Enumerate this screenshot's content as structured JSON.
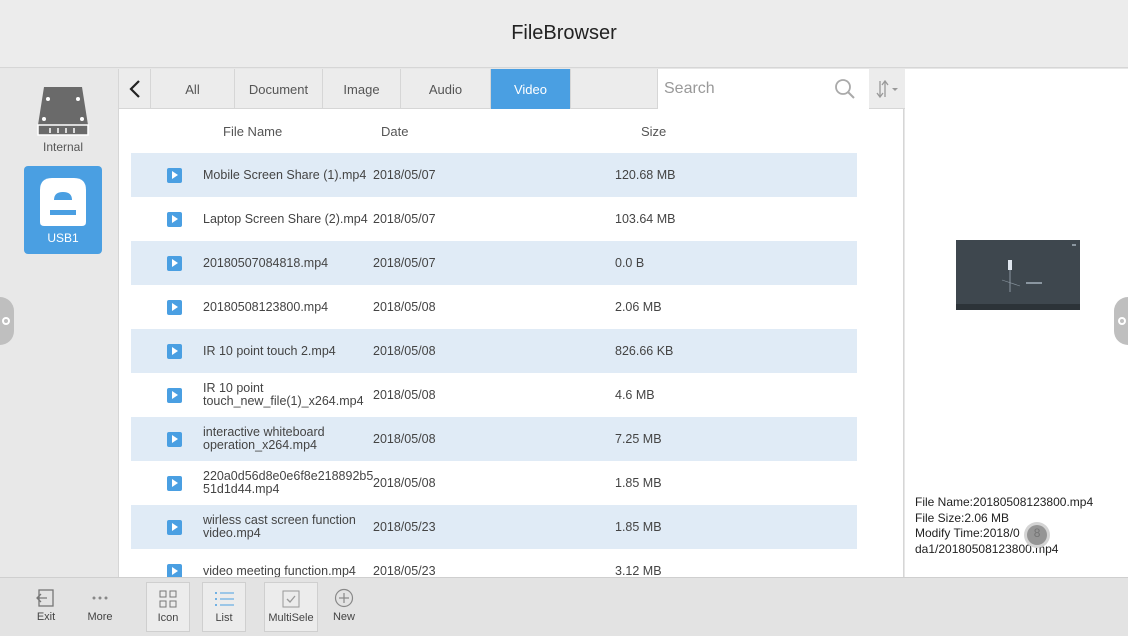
{
  "app": {
    "title": "FileBrowser"
  },
  "devices": [
    {
      "label": "Internal",
      "icon": "hard-drive-icon"
    },
    {
      "label": "USB1",
      "icon": "usb-drive-icon",
      "selected": true
    }
  ],
  "toolbar": {
    "back_icon": "chevron-left-icon",
    "tabs": [
      {
        "label": "All"
      },
      {
        "label": "Document"
      },
      {
        "label": "Image"
      },
      {
        "label": "Audio"
      },
      {
        "label": "Video",
        "active": true
      }
    ],
    "search": {
      "placeholder": "Search",
      "icon": "search-icon"
    },
    "sort_icon": "sort-icon"
  },
  "columns": {
    "name": "File Name",
    "date": "Date",
    "size": "Size"
  },
  "files": [
    {
      "name": "Mobile Screen Share (1).mp4",
      "date": "2018/05/07",
      "size": "120.68 MB"
    },
    {
      "name": "Laptop Screen Share (2).mp4",
      "date": "2018/05/07",
      "size": "103.64 MB"
    },
    {
      "name": "20180507084818.mp4",
      "date": "2018/05/07",
      "size": "0.0 B"
    },
    {
      "name": "20180508123800.mp4",
      "date": "2018/05/08",
      "size": "2.06 MB"
    },
    {
      "name": "IR 10 point touch 2.mp4",
      "date": "2018/05/08",
      "size": "826.66 KB"
    },
    {
      "name": "IR 10 point touch_new_file(1)_x264.mp4",
      "date": "2018/05/08",
      "size": "4.6 MB"
    },
    {
      "name": "interactive whiteboard operation_x264.mp4",
      "date": "2018/05/08",
      "size": "7.25 MB"
    },
    {
      "name": "220a0d56d8e0e6f8e218892b551d1d44.mp4",
      "date": "2018/05/08",
      "size": "1.85 MB"
    },
    {
      "name": "wirless cast screen function video.mp4",
      "date": "2018/05/23",
      "size": "1.85 MB"
    },
    {
      "name": "video meeting function.mp4",
      "date": "2018/05/23",
      "size": "3.12 MB"
    }
  ],
  "preview": {
    "file_name": "File Name:20180508123800.mp4",
    "file_size": "File Size:2.06 MB",
    "modify_time": "Modify Time:2018/0",
    "modify_time_tail": "8",
    "path": "da1/20180508123800.mp4"
  },
  "bottom": {
    "exit": "Exit",
    "more": "More",
    "icon": "Icon",
    "list": "List",
    "multisele": "MultiSele",
    "new": "New"
  },
  "colors": {
    "accent": "#4a9fe2",
    "row_alt": "#e0ebf6"
  }
}
